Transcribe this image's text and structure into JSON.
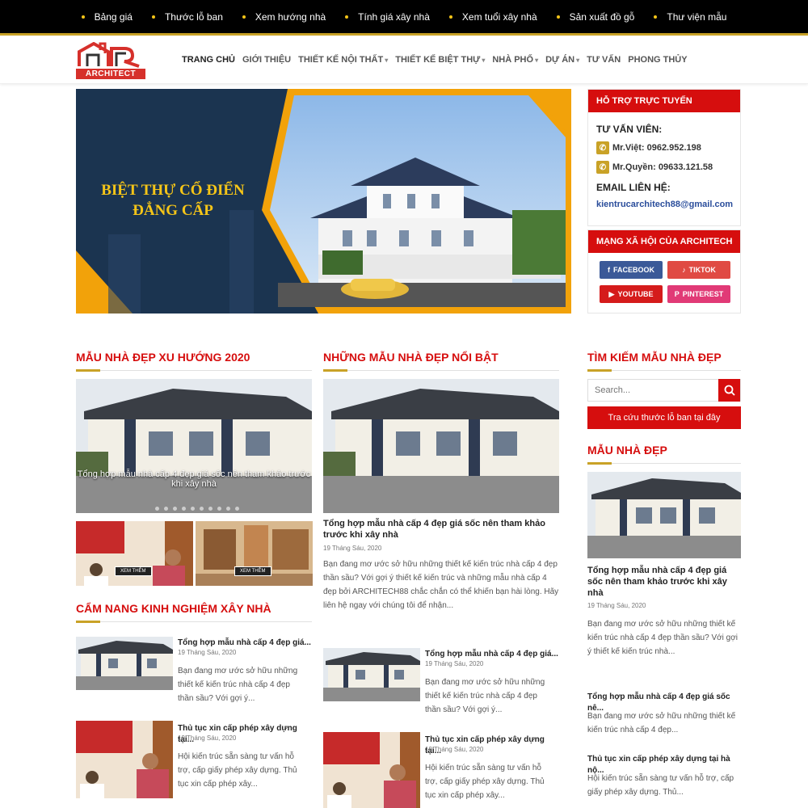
{
  "topbar": {
    "links": [
      "Bảng giá",
      "Thước lỗ ban",
      "Xem hướng nhà",
      "Tính giá xây nhà",
      "Xem tuổi xây nhà",
      "Sản xuất đồ gỗ",
      "Thư viện mẫu"
    ]
  },
  "logo": {
    "text": "ARCHITECT"
  },
  "nav": {
    "items": [
      "TRANG CHỦ",
      "GIỚI THIỆU",
      "THIẾT KẾ NỘI THẤT",
      "THIẾT KẾ BIỆT THỰ",
      "NHÀ PHỐ",
      "DỰ ÁN",
      "TƯ VẤN",
      "PHONG THỦY"
    ]
  },
  "banner": {
    "line1": "BIỆT THỰ CỔ ĐIỂN",
    "line2": "ĐẲNG CẤP"
  },
  "support": {
    "title": "HỖ TRỢ TRỰC TUYẾN",
    "consultant_label": "TƯ VẤN VIÊN:",
    "phone1": "Mr.Việt: 0962.952.198",
    "phone2": "Mr.Quyền: 09633.121.58",
    "email_label": "EMAIL LIÊN HỆ:",
    "email": "kientrucarchitech88@gmail.com"
  },
  "social": {
    "title": "MẠNG XÃ HỘI CỦA ARCHITECH",
    "facebook": "FACEBOOK",
    "tiktok": "TIKTOK",
    "youtube": "YOUTUBE",
    "pinterest": "PINTEREST"
  },
  "sections": {
    "trend": "MẪU NHÀ ĐẸP XU HƯỚNG 2020",
    "featured": "NHỮNG MẪU NHÀ ĐẸP NỔI BẬT",
    "search": "TÌM KIẾM MẪU NHÀ ĐẸP",
    "beautiful": "MẪU NHÀ ĐẸP",
    "handbook": "CẨM NANG KINH NGHIỆM XÂY NHÀ"
  },
  "slider": {
    "caption": "Tổng hợp mẫu nhà cấp 4 đẹp giá sốc nên tham khảo trước khi xây nhà",
    "btn1": "XEM THÊM",
    "btn2": "XEM THÊM"
  },
  "featured_post": {
    "title": "Tổng hợp mẫu nhà cấp 4 đẹp giá sốc nên tham khảo trước khi xây nhà",
    "date": "19 Tháng Sáu, 2020",
    "excerpt": "Bạn đang mơ ước sở hữu những thiết kế kiến trúc nhà cấp 4 đẹp thần sầu? Với gợi ý thiết kế kiến trúc và những mẫu nhà cấp 4 đẹp bởi ARCHITECH88 chắc chắn có thể khiến bạn hài lòng. Hãy liên hệ ngay với chúng tôi để nhận..."
  },
  "search": {
    "placeholder": "Search...",
    "button": "Tra cứu thước lỗ ban tại đây"
  },
  "sidebar_post": {
    "title": "Tổng hợp mẫu nhà cấp 4 đẹp giá sốc nên tham khảo trước khi xây nhà",
    "date": "19 Tháng Sáu, 2020",
    "excerpt": "Bạn đang mơ ước sở hữu những thiết kế kiến trúc nhà cấp 4 đẹp thần sầu? Với gợi ý thiết kế kiến trúc nhà..."
  },
  "sidebar_list": [
    {
      "title": "Tổng hợp mẫu nhà cấp 4 đẹp giá sốc nê...",
      "excerpt": "Bạn đang mơ ước sở hữu những thiết kế kiến trúc nhà cấp 4 đẹp..."
    },
    {
      "title": "Thủ tục xin cấp phép xây dựng tại hà nộ...",
      "excerpt": "Hội kiến trúc sẵn sàng tư vấn hỗ trợ, cấp giấy phép xây dựng. Thủ..."
    }
  ],
  "handbook_posts": [
    {
      "title": "Tổng hợp mẫu nhà cấp 4 đẹp giá...",
      "date": "19 Tháng Sáu, 2020",
      "excerpt": "Bạn đang mơ ước sở hữu những thiết kế kiến trúc nhà cấp 4 đẹp thần sầu? Với gợi ý..."
    },
    {
      "title": "Thủ tục xin cấp phép xây dựng tại...",
      "date": "19 Tháng Sáu, 2020",
      "excerpt": "Hội kiến trúc sẵn sàng tư vấn hỗ trợ, cấp giấy phép xây dựng. Thủ tục xin cấp phép xây..."
    }
  ],
  "handbook_posts2": [
    {
      "title": "Tổng hợp mẫu nhà cấp 4 đẹp giá...",
      "date": "19 Tháng Sáu, 2020",
      "excerpt": "Bạn đang mơ ước sở hữu những thiết kế kiến trúc nhà cấp 4 đẹp thần sầu? Với gợi ý..."
    },
    {
      "title": "Thủ tục xin cấp phép xây dựng tại...",
      "date": "19 Tháng Sáu, 2020",
      "excerpt": "Hội kiến trúc sẵn sàng tư vấn hỗ trợ, cấp giấy phép xây dựng. Thủ tục xin cấp phép xây..."
    }
  ],
  "colors": {
    "accent": "#d60e0e",
    "gold": "#c9a227",
    "topbar": "#000000"
  }
}
